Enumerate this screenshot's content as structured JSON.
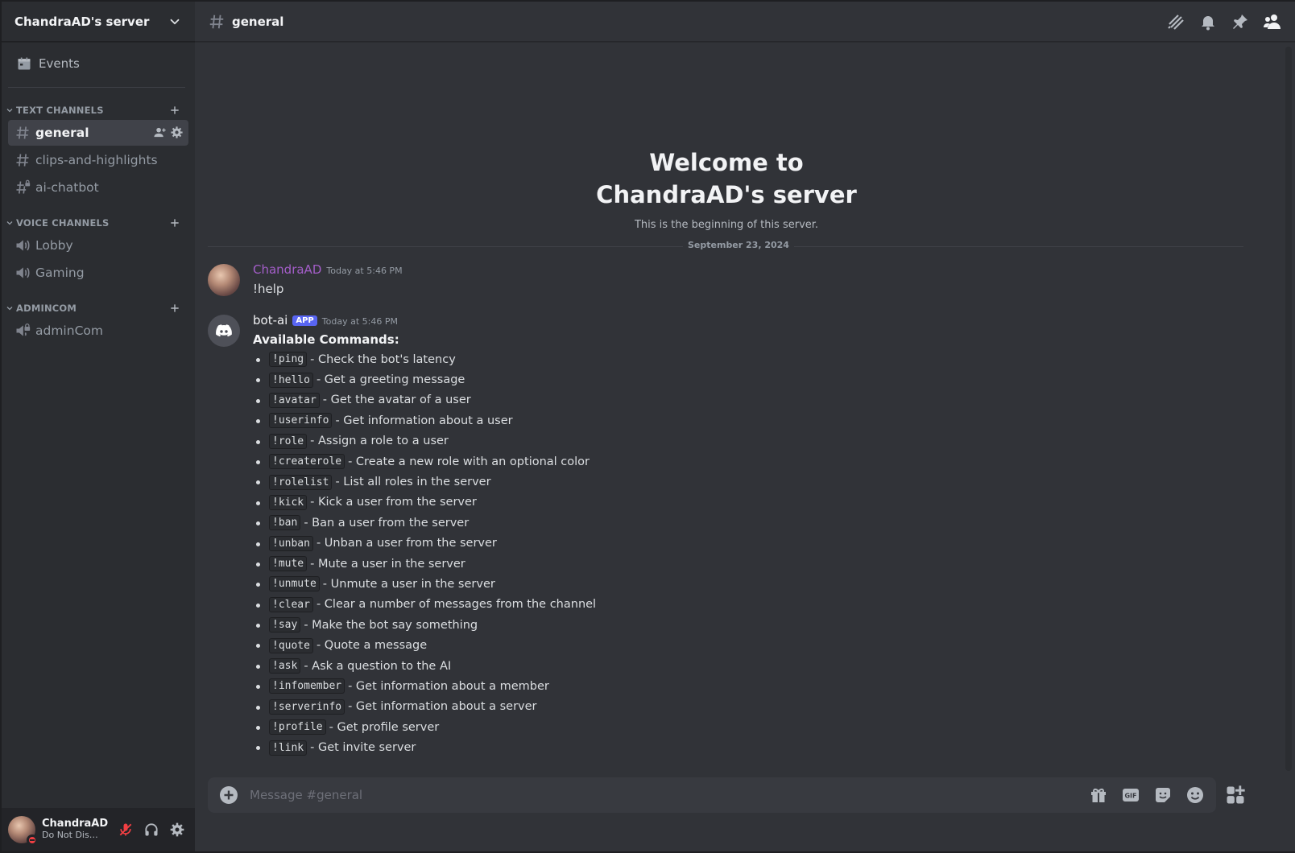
{
  "server": {
    "name": "ChandraAD's server"
  },
  "events_label": "Events",
  "categories": [
    {
      "label": "TEXT CHANNELS",
      "channels": [
        {
          "label": "general",
          "active": true
        },
        {
          "label": "clips-and-highlights"
        },
        {
          "label": "ai-chatbot"
        }
      ]
    },
    {
      "label": "VOICE CHANNELS",
      "channels": [
        {
          "label": "Lobby"
        },
        {
          "label": "Gaming"
        }
      ]
    },
    {
      "label": "ADMINCOM",
      "channels": [
        {
          "label": "adminCom"
        }
      ]
    }
  ],
  "user": {
    "name": "ChandraAD",
    "status": "Do Not Disturb"
  },
  "topbar": {
    "channel": "general"
  },
  "welcome": {
    "line1": "Welcome to",
    "line2": "ChandraAD's server",
    "subtitle": "This is the beginning of this server."
  },
  "date_divider": "September 23, 2024",
  "messages": [
    {
      "author": "ChandraAD",
      "timestamp": "Today at 5:46 PM",
      "text": "!help"
    },
    {
      "author": "bot-ai",
      "badge": "APP",
      "timestamp": "Today at 5:46 PM",
      "title": "Available Commands:",
      "commands": [
        {
          "cmd": "!ping",
          "desc": "- Check the bot's latency"
        },
        {
          "cmd": "!hello",
          "desc": "- Get a greeting message"
        },
        {
          "cmd": "!avatar",
          "desc": "- Get the avatar of a user"
        },
        {
          "cmd": "!userinfo",
          "desc": "- Get information about a user"
        },
        {
          "cmd": "!role",
          "desc": "- Assign a role to a user"
        },
        {
          "cmd": "!createrole",
          "desc": "- Create a new role with an optional color"
        },
        {
          "cmd": "!rolelist",
          "desc": "- List all roles in the server"
        },
        {
          "cmd": "!kick",
          "desc": "- Kick a user from the server"
        },
        {
          "cmd": "!ban",
          "desc": "- Ban a user from the server"
        },
        {
          "cmd": "!unban",
          "desc": "- Unban a user from the server"
        },
        {
          "cmd": "!mute",
          "desc": "- Mute a user in the server"
        },
        {
          "cmd": "!unmute",
          "desc": "- Unmute a user in the server"
        },
        {
          "cmd": "!clear",
          "desc": "- Clear a number of messages from the channel"
        },
        {
          "cmd": "!say",
          "desc": "- Make the bot say something"
        },
        {
          "cmd": "!quote",
          "desc": "- Quote a message"
        },
        {
          "cmd": "!ask",
          "desc": "- Ask a question to the AI"
        },
        {
          "cmd": "!infomember",
          "desc": "- Get information about a member"
        },
        {
          "cmd": "!serverinfo",
          "desc": "- Get information about a server"
        },
        {
          "cmd": "!profile",
          "desc": "- Get profile server"
        },
        {
          "cmd": "!link",
          "desc": "- Get invite server"
        }
      ]
    }
  ],
  "composer": {
    "placeholder": "Message #general"
  },
  "colors": {
    "accent": "#5865f2",
    "user_name": "#a45ec9",
    "dnd": "#f23f43"
  }
}
